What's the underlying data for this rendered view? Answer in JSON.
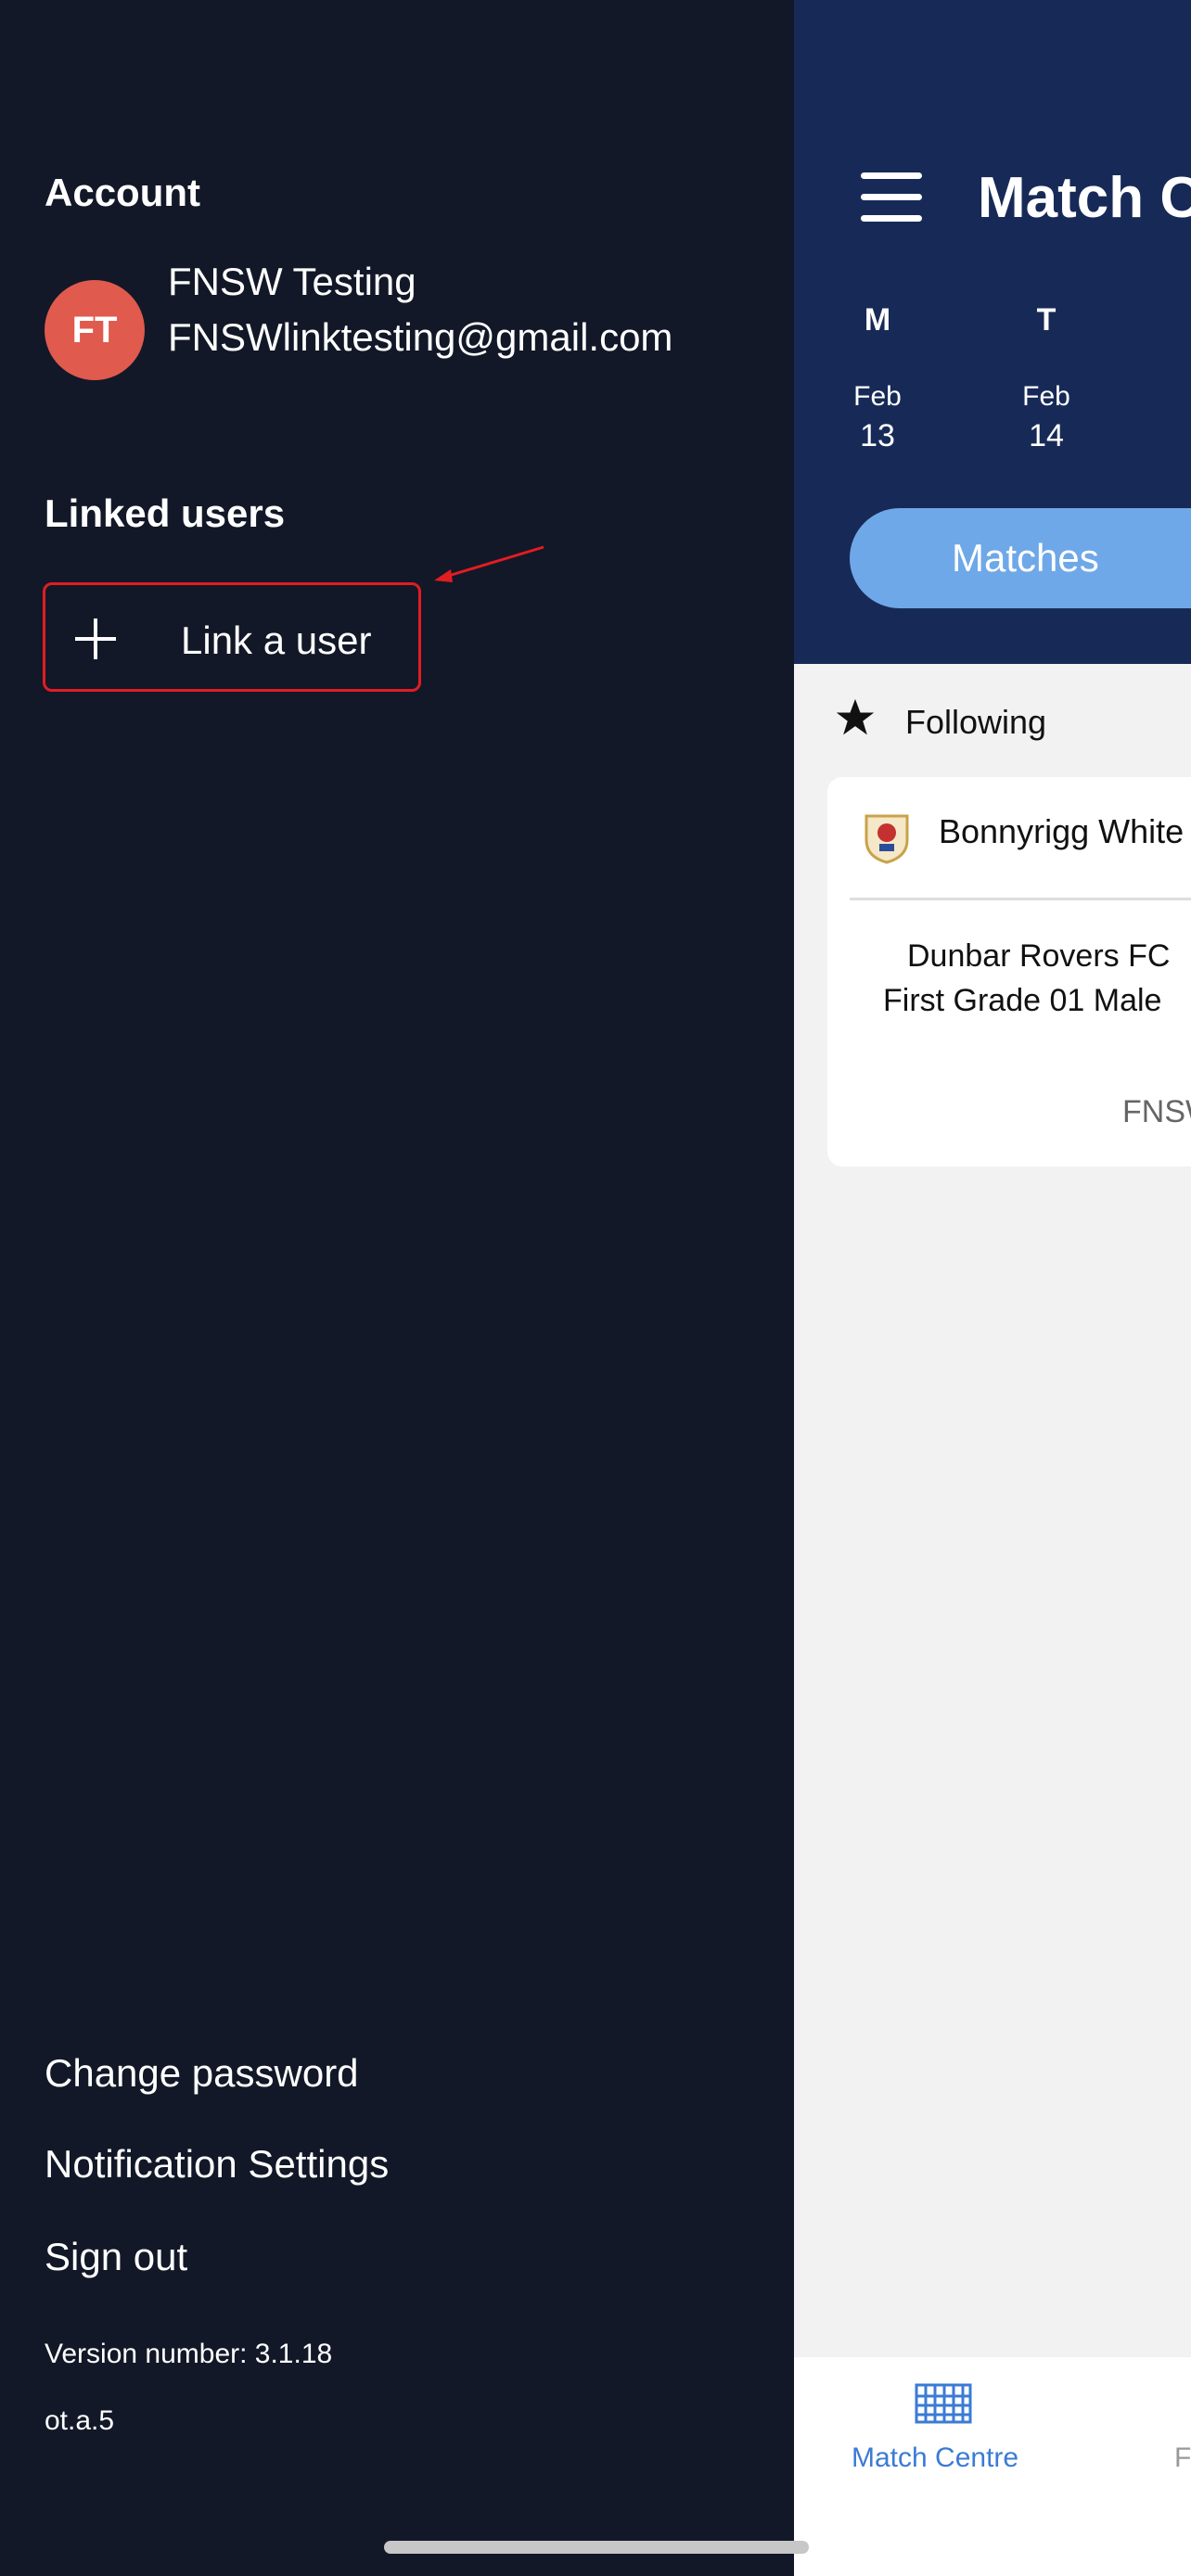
{
  "drawer": {
    "account_title": "Account",
    "avatar_initials": "FT",
    "user_name": "FNSW Testing",
    "user_email": "FNSWlinktesting@gmail.com",
    "linked_users_title": "Linked users",
    "link_user_label": "Link a user",
    "change_password": "Change password",
    "notification_settings": "Notification Settings",
    "sign_out": "Sign out",
    "version": "Version number: 3.1.18",
    "build": "ot.a.5"
  },
  "main": {
    "title": "Match C",
    "days": [
      {
        "letter": "M",
        "month": "Feb",
        "date": "13"
      },
      {
        "letter": "T",
        "month": "Feb",
        "date": "14"
      }
    ],
    "segment_label": "Matches",
    "following_label": "Following",
    "card": {
      "team": "Bonnyrigg White",
      "line1": "Dunbar Rovers FC",
      "line2": "First Grade 01 Male",
      "footer": "FNSW"
    },
    "tab_label": "Match Centre",
    "tab_label_2": "F"
  },
  "colors": {
    "drawer_bg": "#121827",
    "header_bg": "#172a57",
    "avatar_bg": "#e05a4e",
    "highlight": "#e11d22",
    "accent": "#3a7bd5"
  }
}
